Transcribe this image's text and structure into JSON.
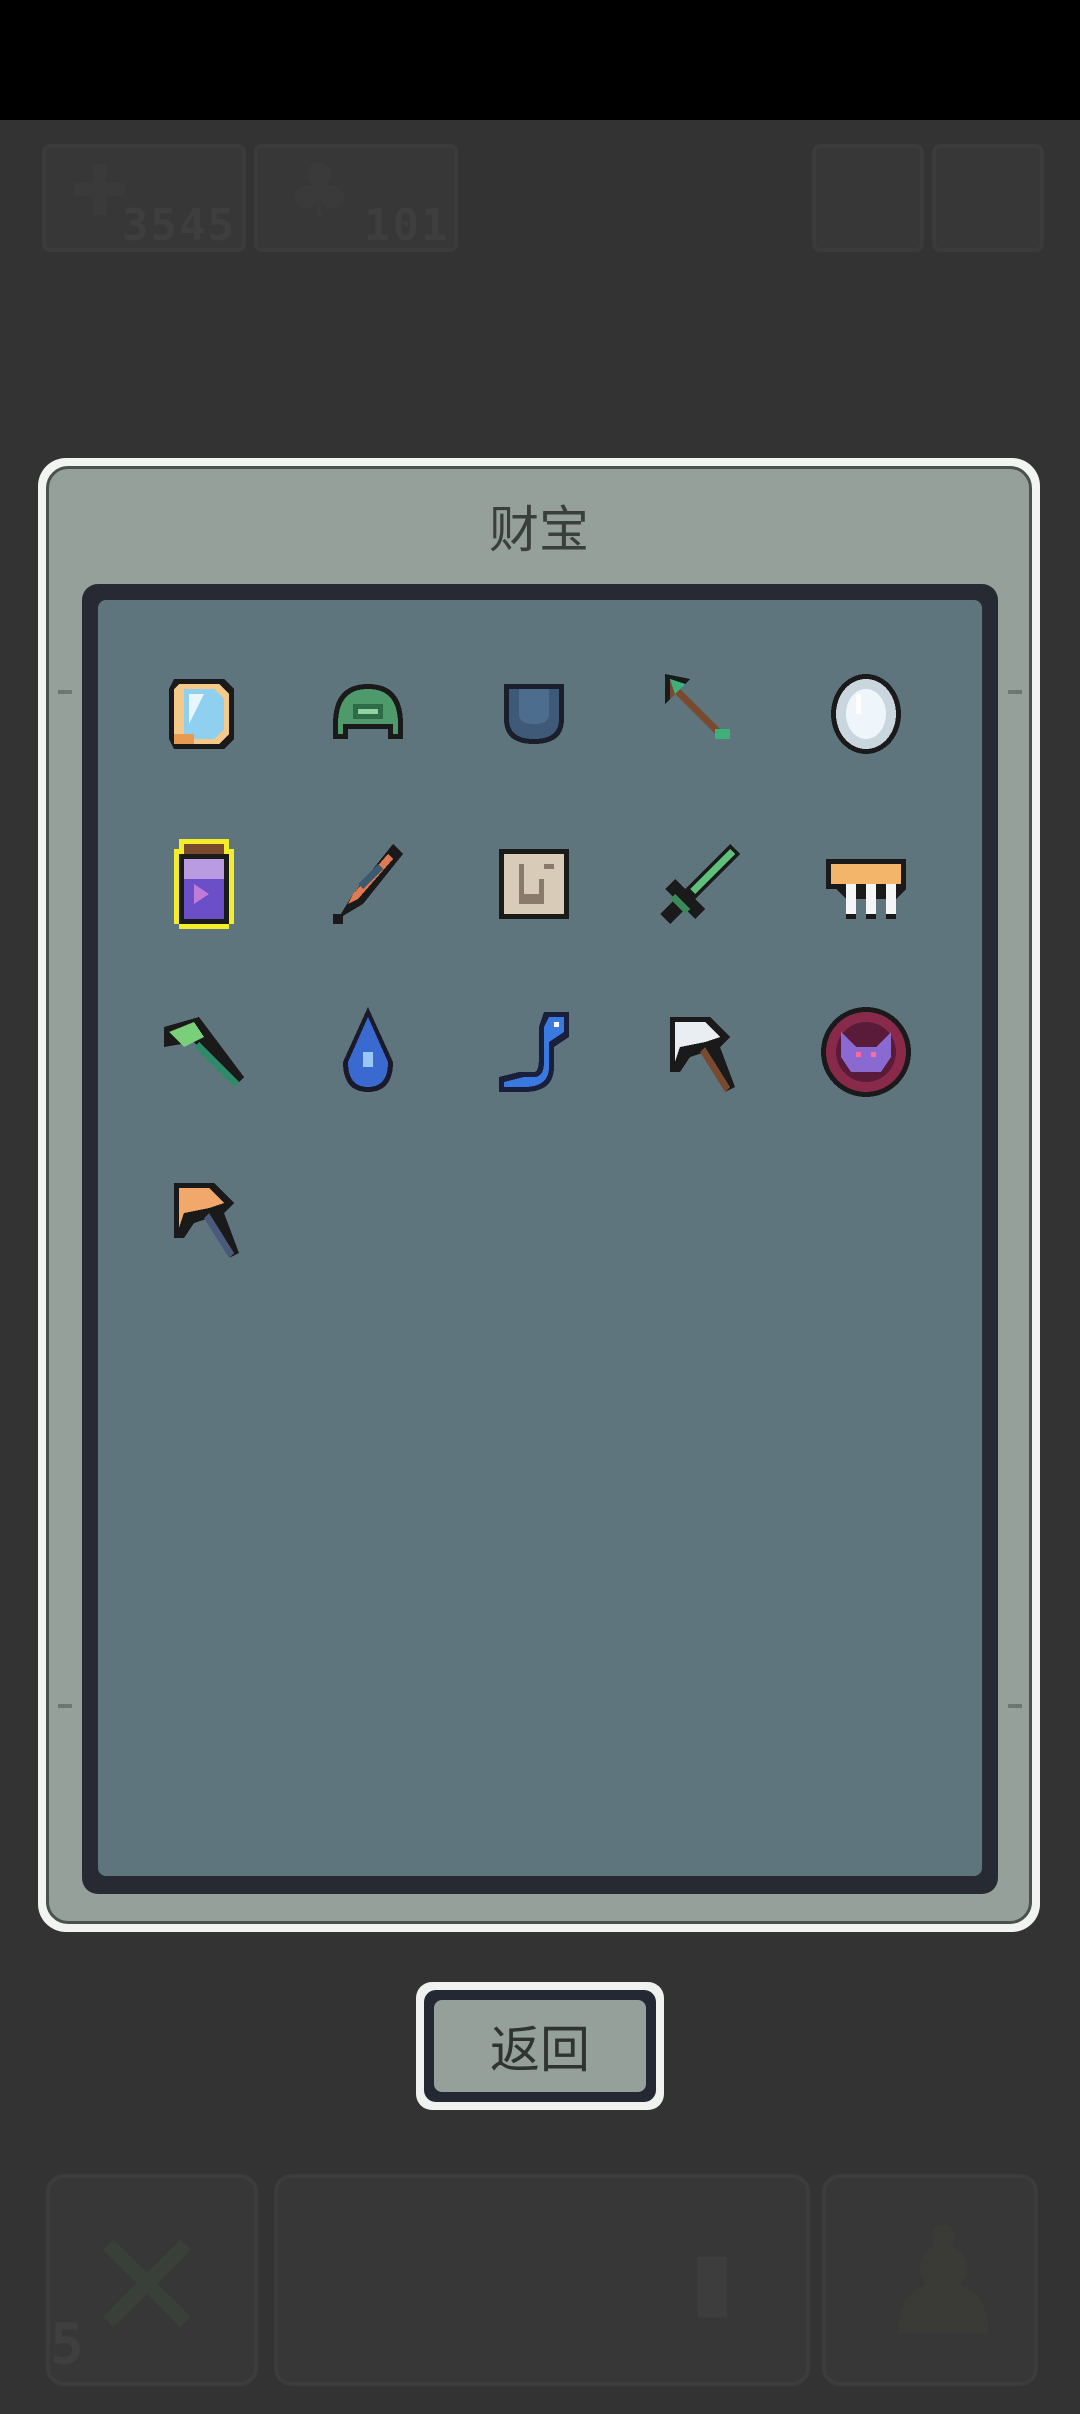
{
  "hud": {
    "gold_count": "3545",
    "gem_count": "101"
  },
  "panel": {
    "title": "财宝",
    "items": [
      {
        "icon": "crystal-scroll-icon"
      },
      {
        "icon": "green-helmet-icon"
      },
      {
        "icon": "blue-pocket-icon"
      },
      {
        "icon": "green-arrow-icon"
      },
      {
        "icon": "silver-mirror-icon"
      },
      {
        "icon": "purple-potion-jar-icon",
        "selected": true
      },
      {
        "icon": "ember-feather-icon"
      },
      {
        "icon": "ancient-map-icon"
      },
      {
        "icon": "green-sword-icon"
      },
      {
        "icon": "bone-claw-icon"
      },
      {
        "icon": "green-axe-icon"
      },
      {
        "icon": "water-drop-icon"
      },
      {
        "icon": "blue-serpent-icon"
      },
      {
        "icon": "white-pickaxe-icon"
      },
      {
        "icon": "demon-emblem-icon"
      },
      {
        "icon": "orange-pickaxe-icon"
      }
    ]
  },
  "back_label": "返回",
  "bottom": {
    "badge": "5"
  },
  "colors": {
    "background": "#333333",
    "panel": "#94a099",
    "grid": "#5e757e",
    "selection": "#f4ee2a"
  }
}
